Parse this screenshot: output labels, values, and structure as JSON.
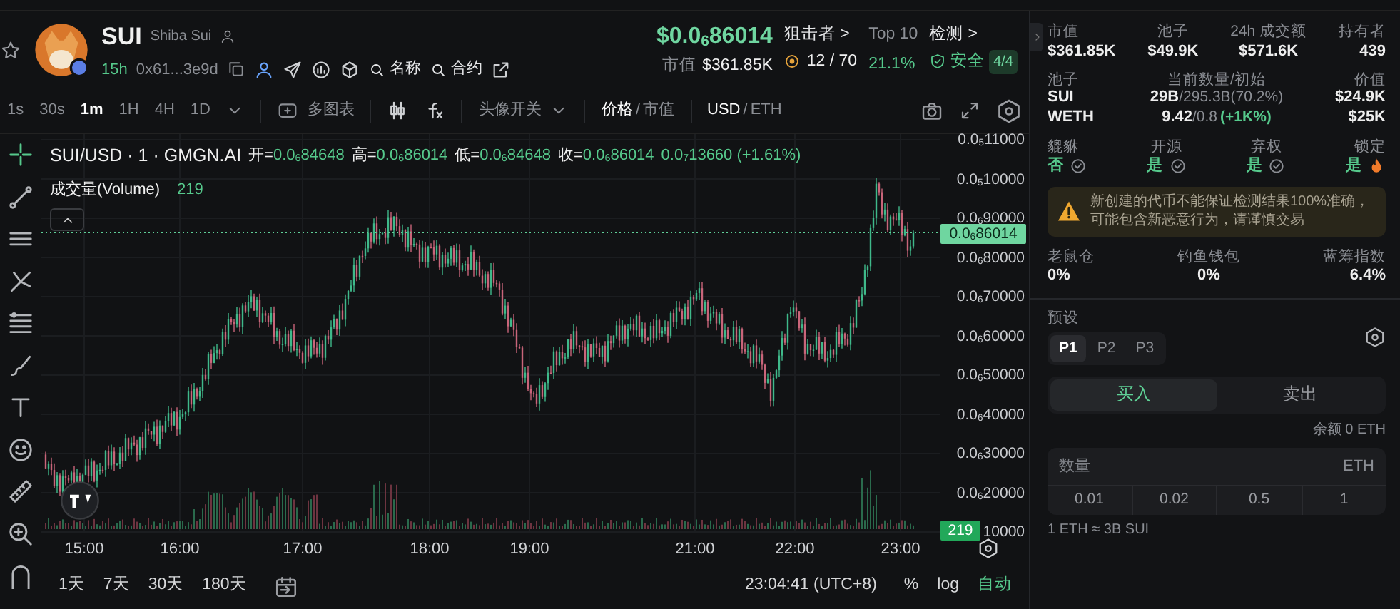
{
  "token": {
    "symbol": "SUI",
    "name": "Shiba Sui",
    "age": "15h",
    "address": "0x61...3e9d",
    "search_links": [
      "名称",
      "合约"
    ]
  },
  "price": {
    "value": "$0.0$_{6}$86014",
    "market_cap_label": "市值",
    "market_cap": "$361.85K"
  },
  "snipers": {
    "label": "狙击者 >",
    "value": "12 / 70"
  },
  "top10": {
    "label": "Top 10",
    "value": "21.1%"
  },
  "check": {
    "label": "检测 >",
    "status": "安全",
    "score": "4/4"
  },
  "toolbar": {
    "intervals": [
      {
        "label": "1s",
        "selected": false
      },
      {
        "label": "30s",
        "selected": false
      },
      {
        "label": "1m",
        "selected": true
      },
      {
        "label": "1H",
        "selected": false
      },
      {
        "label": "4H",
        "selected": false
      },
      {
        "label": "1D",
        "selected": false
      }
    ],
    "multi_chart": "多图表",
    "avatar_toggle": "头像开关",
    "price_modes": {
      "separator": "/",
      "options": [
        {
          "label": "价格",
          "selected": true
        },
        {
          "label": "市值",
          "selected": false
        }
      ]
    },
    "currencies": {
      "separator": "/",
      "options": [
        {
          "label": "USD",
          "selected": true
        },
        {
          "label": "ETH",
          "selected": false
        }
      ]
    }
  },
  "chart": {
    "pair_label": "SUI/USD · 1 · GMGN.AI",
    "ohlc": [
      {
        "label": "开=",
        "value": "0.0$_{6}$84648"
      },
      {
        "label": "高=",
        "value": "0.0$_{6}$86014"
      },
      {
        "label": "低=",
        "value": "0.0$_{6}$84648"
      },
      {
        "label": "收=",
        "value": "0.0$_{6}$86014"
      }
    ],
    "change": "0.0$_{7}$13660 (+1.61%)",
    "volume_label": "成交量(Volume)",
    "volume_value": "219",
    "price_ticks": [
      "0.0$_{5}$11000",
      "0.0$_{5}$10000",
      "0.0$_{6}$90000",
      "0.0$_{6}$80000",
      "0.0$_{6}$70000",
      "0.0$_{6}$60000",
      "0.0$_{6}$50000",
      "0.0$_{6}$40000",
      "0.0$_{6}$30000",
      "0.0$_{6}$20000",
      "10000"
    ],
    "last_price": "0.0$_{6}$86014",
    "volume_tag": "219",
    "time_ticks": [
      "15:00",
      "16:00",
      "17:00",
      "18:00",
      "19:00",
      "21:00",
      "22:00",
      "23:00"
    ]
  },
  "bottom_bar": {
    "ranges": [
      "1天",
      "7天",
      "30天",
      "180天"
    ],
    "clock": "23:04:41 (UTC+8)",
    "scale_options": [
      {
        "label": "%",
        "selected": false
      },
      {
        "label": "log",
        "selected": false
      },
      {
        "label": "自动",
        "selected": true
      }
    ]
  },
  "overview": [
    {
      "label": "市值",
      "value": "$361.85K"
    },
    {
      "label": "池子",
      "value": "$49.9K"
    },
    {
      "label": "24h 成交额",
      "value": "$571.6K"
    },
    {
      "label": "持有者",
      "value": "439"
    }
  ],
  "pool": {
    "headers": [
      "池子",
      "当前数量/初始",
      "价值"
    ],
    "rows": [
      {
        "token": "SUI",
        "current": "29B",
        "initial": "/295.3B(70.2%)",
        "value": "$24.9K"
      },
      {
        "token": "WETH",
        "current": "9.42",
        "initial": "/0.8",
        "change": "(+1K%)",
        "value": "$25K"
      }
    ]
  },
  "security": [
    {
      "label": "貔貅",
      "value": "否",
      "kind": "check"
    },
    {
      "label": "开源",
      "value": "是",
      "kind": "check"
    },
    {
      "label": "弃权",
      "value": "是",
      "kind": "check"
    },
    {
      "label": "锁定",
      "value": "是",
      "kind": "fire"
    }
  ],
  "warning": "新创建的代币不能保证检测结果100%准确，可能包含新恶意行为，请谨慎交易",
  "risk_stats": [
    {
      "label": "老鼠仓",
      "value": "0%"
    },
    {
      "label": "钓鱼钱包",
      "value": "0%"
    },
    {
      "label": "蓝筹指数",
      "value": "6.4%"
    }
  ],
  "trade": {
    "preset_label": "预设",
    "presets": [
      {
        "label": "P1",
        "selected": true
      },
      {
        "label": "P2",
        "selected": false
      },
      {
        "label": "P3",
        "selected": false
      }
    ],
    "sides": [
      {
        "label": "买入",
        "selected": true
      },
      {
        "label": "卖出",
        "selected": false
      }
    ],
    "balance": "余额 0 ETH",
    "amount": {
      "placeholder": "数量",
      "unit": "ETH"
    },
    "quick_amounts": [
      "0.01",
      "0.02",
      "0.5",
      "1"
    ],
    "rate": "1 ETH ≈ 3B SUI"
  }
}
